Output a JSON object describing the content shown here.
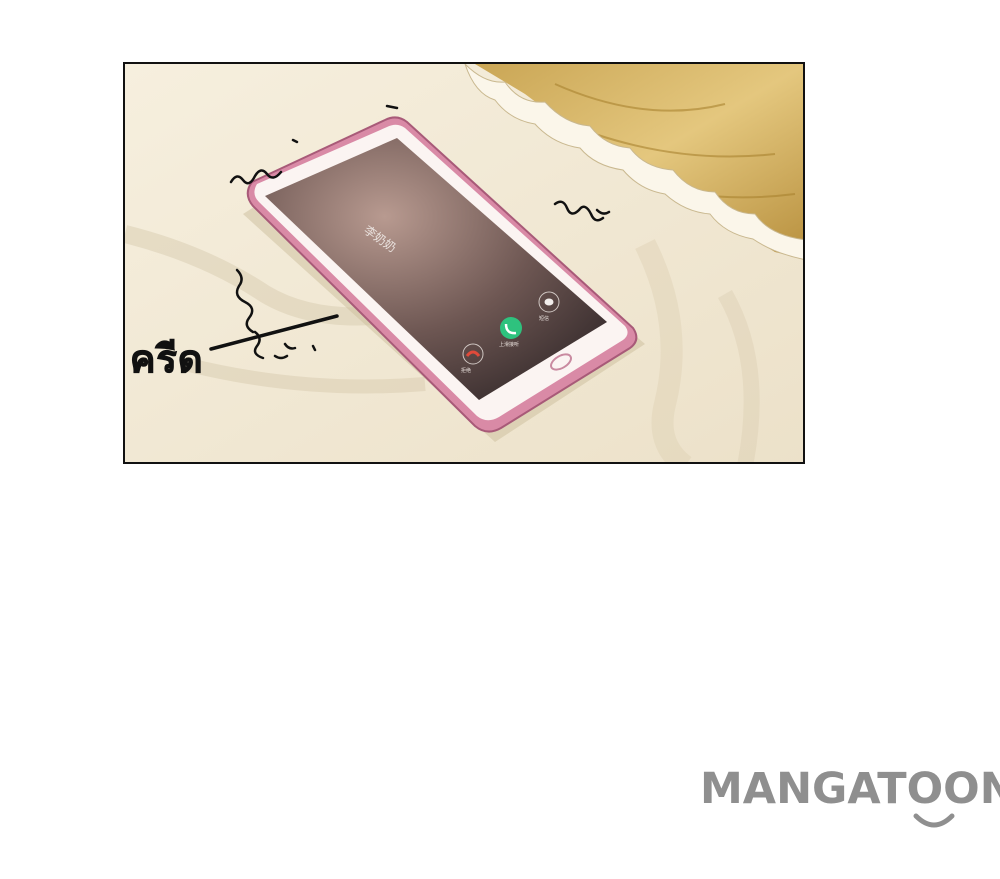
{
  "panel": {
    "sound_effect": "ครีด",
    "phone": {
      "caller_name": "李奶奶",
      "decline_label": "拒绝",
      "accept_label": "上滑接听",
      "message_label": "短信"
    }
  },
  "watermark": {
    "brand": "MANGATOON"
  },
  "colors": {
    "page_background": "#ffffff",
    "panel_border": "#111111",
    "sheet": "#f2ead8",
    "wood": "#d8b766",
    "phone_case": "#d98aa6",
    "accept_button": "#2ec27e",
    "decline_icon": "#e04a3a",
    "watermark": "#8f8f8f"
  }
}
